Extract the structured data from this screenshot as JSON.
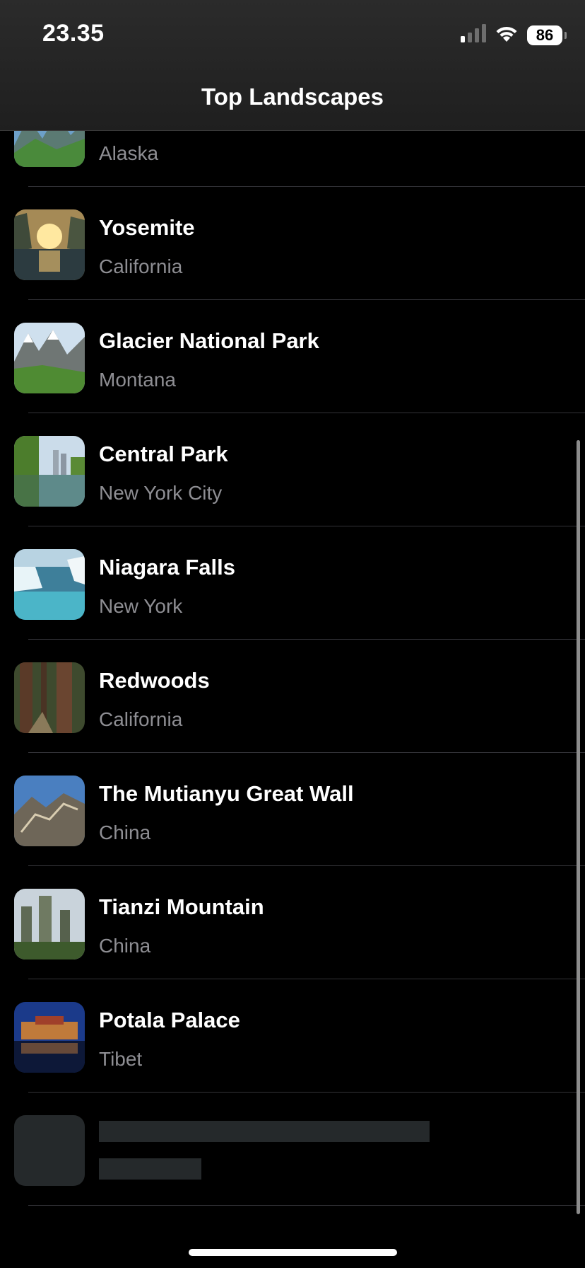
{
  "status_bar": {
    "time": "23.35",
    "battery": "86",
    "signal_icon": "cellular-signal-icon",
    "wifi_icon": "wifi-icon"
  },
  "nav": {
    "title": "Top Landscapes"
  },
  "list": {
    "items": [
      {
        "title": "",
        "subtitle": "Alaska",
        "image": "alaska-photo"
      },
      {
        "title": "Yosemite",
        "subtitle": "California",
        "image": "yosemite-photo"
      },
      {
        "title": "Glacier National Park",
        "subtitle": "Montana",
        "image": "glacier-photo"
      },
      {
        "title": "Central Park",
        "subtitle": "New York City",
        "image": "central-park-photo"
      },
      {
        "title": "Niagara Falls",
        "subtitle": "New York",
        "image": "niagara-photo"
      },
      {
        "title": "Redwoods",
        "subtitle": "California",
        "image": "redwoods-photo"
      },
      {
        "title": "The Mutianyu Great Wall",
        "subtitle": "China",
        "image": "great-wall-photo"
      },
      {
        "title": "Tianzi Mountain",
        "subtitle": "China",
        "image": "tianzi-photo"
      },
      {
        "title": "Potala Palace",
        "subtitle": "Tibet",
        "image": "potala-photo"
      }
    ],
    "loading_placeholder": true
  },
  "colors": {
    "background": "#000000",
    "header": "#262626",
    "subtitle": "#8e8e93",
    "separator": "#333338",
    "skeleton": "#25292b"
  }
}
